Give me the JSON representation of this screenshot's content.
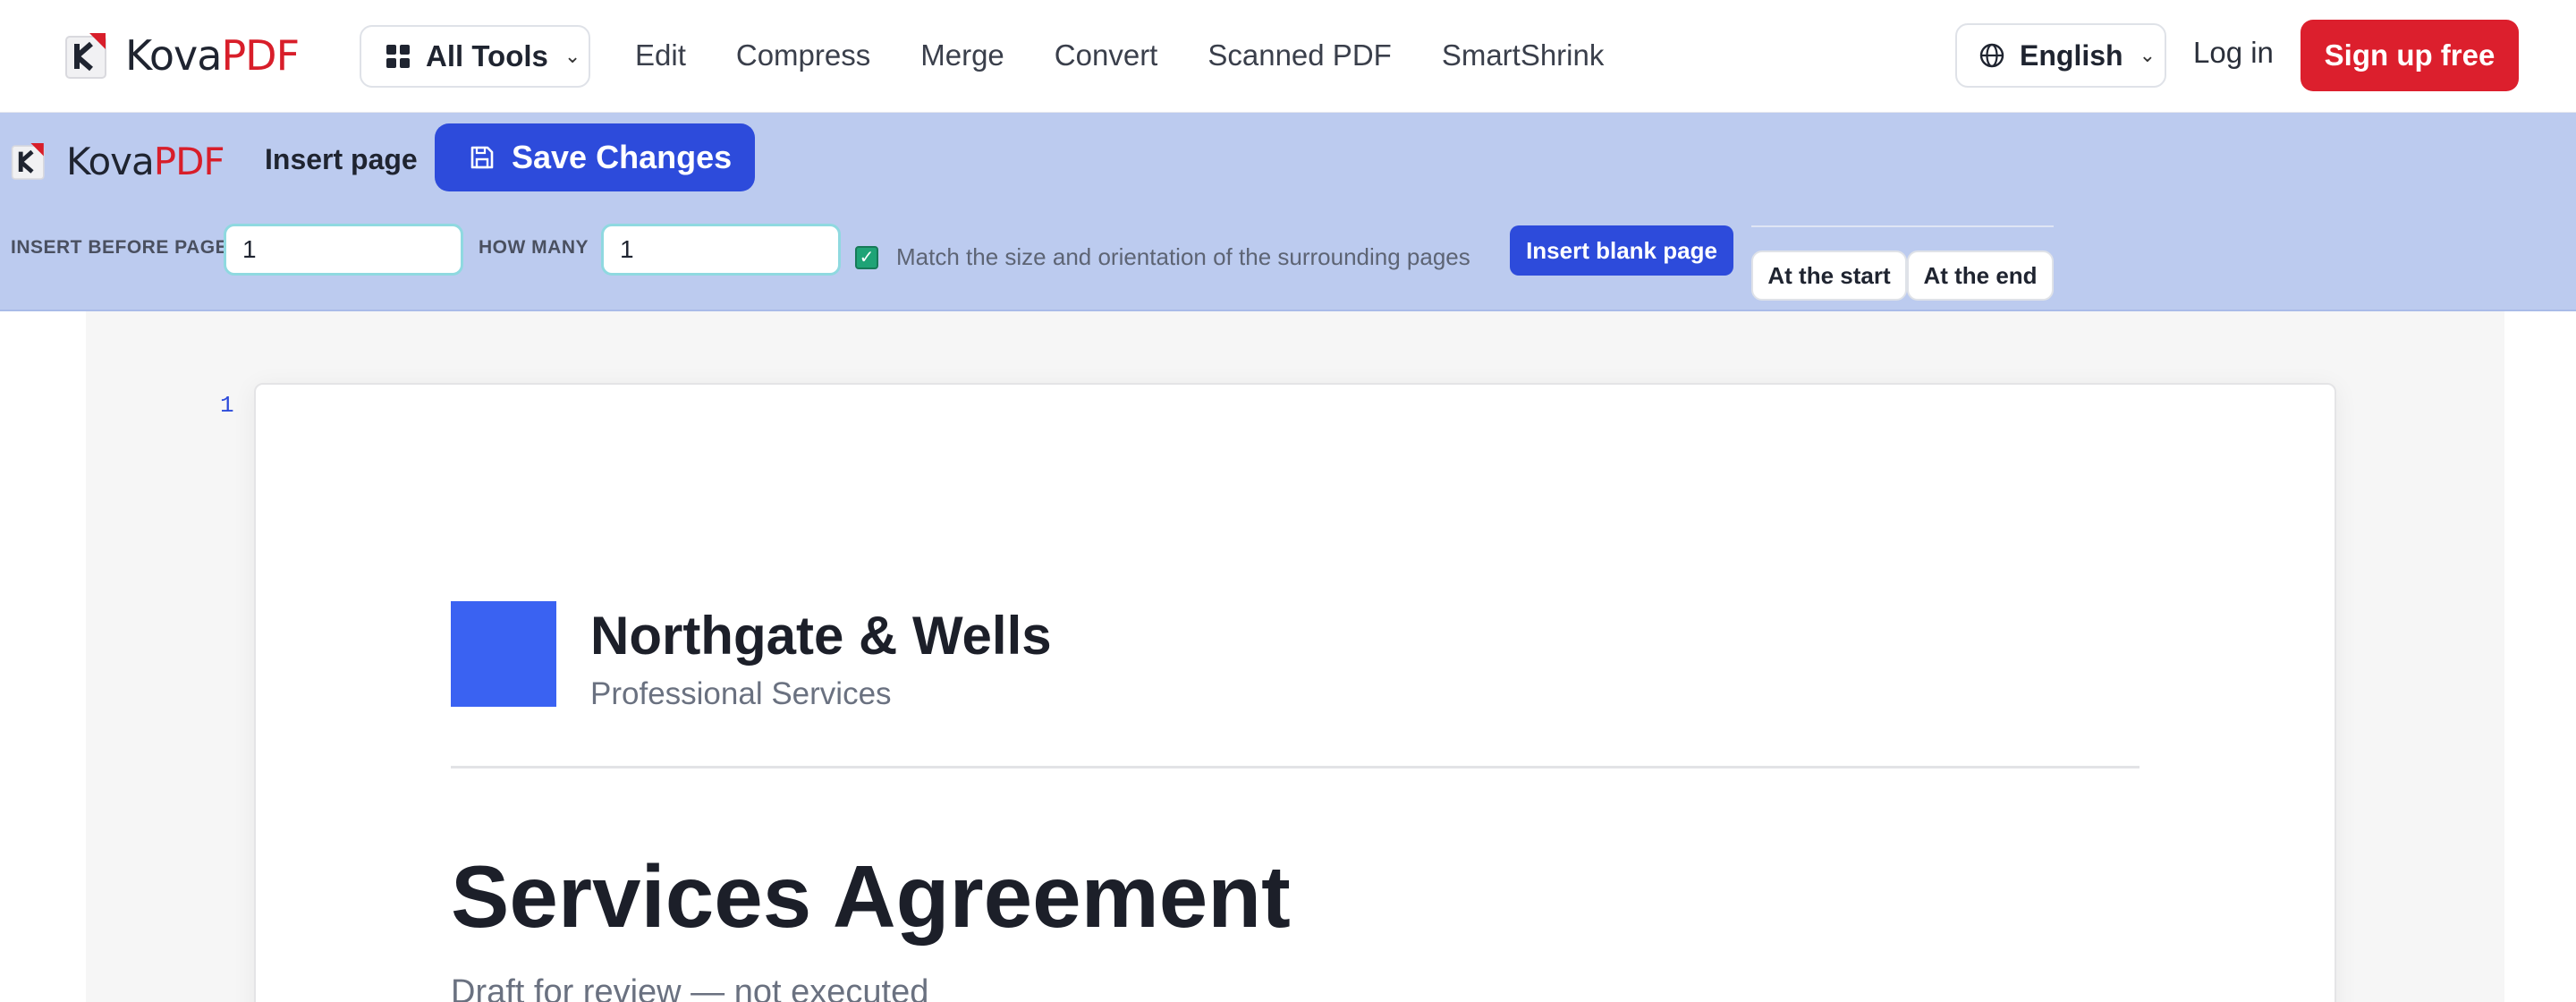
{
  "brand": {
    "name_left": "Kova",
    "name_right": "PDF",
    "accent": "#d81e2a"
  },
  "topnav": {
    "all_tools": "All Tools",
    "links": [
      "Edit",
      "Compress",
      "Merge",
      "Convert",
      "Scanned PDF",
      "SmartShrink"
    ],
    "language": "English",
    "login": "Log in",
    "signup": "Sign up free"
  },
  "toolbar": {
    "tab": "Insert page",
    "save": "Save Changes",
    "insert_before_label": "INSERT BEFORE PAGE",
    "insert_before_value": "1",
    "how_many_label": "HOW MANY",
    "how_many_value": "1",
    "match_checked": true,
    "match_label": "Match the size and orientation of the surrounding pages",
    "insert_blank": "Insert blank page",
    "at_start": "At the start",
    "at_end": "At the end"
  },
  "document": {
    "page_number": "1",
    "company": "Northgate & Wells",
    "company_sub": "Professional Services",
    "title": "Services Agreement",
    "subtitle": "Draft for review — not executed",
    "brand_color": "#3a62f2"
  },
  "icons": [
    "kovapdf-logo-icon",
    "grid-icon",
    "chevron-down-icon",
    "globe-icon",
    "save-disk-icon",
    "checkbox-checked-icon"
  ]
}
